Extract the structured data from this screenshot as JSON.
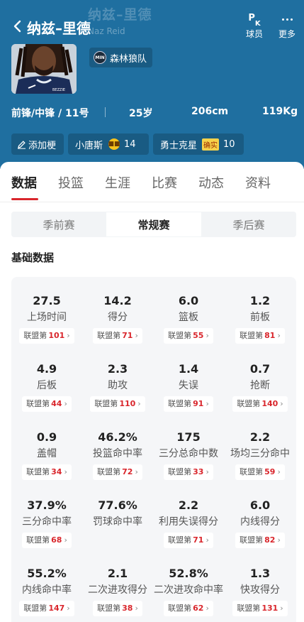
{
  "header": {
    "title": "纳兹–里德",
    "bg_name": "纳兹–里德",
    "bg_name_en": "Naz Reid",
    "actions": [
      {
        "label": "球员",
        "icon": "pk-icon"
      },
      {
        "label": "更多",
        "icon": "more-dots-icon"
      }
    ],
    "team": "森林狼队",
    "position": "前锋/中锋 / 11号",
    "age": "25岁",
    "height": "206cm",
    "weight": "119Kg",
    "tags": [
      {
        "label": "添加梗",
        "icon": "pencil-icon"
      },
      {
        "label": "小唐斯",
        "count": "14",
        "icon": "cool-emoji-icon"
      },
      {
        "label": "勇士克星",
        "badge": "确实",
        "count": "10"
      }
    ]
  },
  "tabs": [
    "数据",
    "投篮",
    "生涯",
    "比赛",
    "动态",
    "资料"
  ],
  "active_tab": "数据",
  "season_types": [
    "季前赛",
    "常规赛",
    "季后赛"
  ],
  "active_season_type": "常规赛",
  "section_title": "基础数据",
  "rank_prefix": "联盟第",
  "stats": [
    {
      "value": "27.5",
      "label": "上场时间",
      "rank": "101"
    },
    {
      "value": "14.2",
      "label": "得分",
      "rank": "71"
    },
    {
      "value": "6.0",
      "label": "篮板",
      "rank": "55"
    },
    {
      "value": "1.2",
      "label": "前板",
      "rank": "81"
    },
    {
      "value": "4.9",
      "label": "后板",
      "rank": "44"
    },
    {
      "value": "2.3",
      "label": "助攻",
      "rank": "110"
    },
    {
      "value": "1.4",
      "label": "失误",
      "rank": "91"
    },
    {
      "value": "0.7",
      "label": "抢断",
      "rank": "140"
    },
    {
      "value": "0.9",
      "label": "盖帽",
      "rank": "34"
    },
    {
      "value": "46.2%",
      "label": "投篮命中率",
      "rank": "72"
    },
    {
      "value": "175",
      "label": "三分总命中数",
      "rank": "33"
    },
    {
      "value": "2.2",
      "label": "场均三分命中",
      "rank": "59"
    },
    {
      "value": "37.9%",
      "label": "三分命中率",
      "rank": "68"
    },
    {
      "value": "77.6%",
      "label": "罚球命中率",
      "rank": ""
    },
    {
      "value": "2.2",
      "label": "利用失误得分",
      "rank": "71"
    },
    {
      "value": "6.0",
      "label": "内线得分",
      "rank": "82"
    },
    {
      "value": "55.2%",
      "label": "内线命中率",
      "rank": "147"
    },
    {
      "value": "2.1",
      "label": "二次进攻得分",
      "rank": "38"
    },
    {
      "value": "52.8%",
      "label": "二次进攻命中率",
      "rank": "62"
    },
    {
      "value": "1.3",
      "label": "快攻得分",
      "rank": "131"
    }
  ],
  "colors": {
    "header_bg": "#1f6fa0",
    "accent": "#d9262c"
  }
}
